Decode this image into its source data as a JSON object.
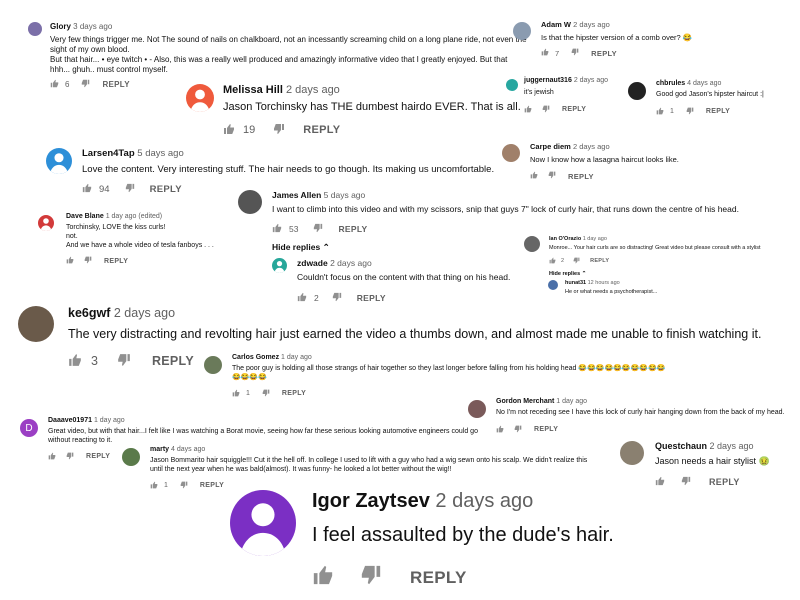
{
  "comments": {
    "glory": {
      "author": "Glory",
      "time": "3 days ago",
      "lines": [
        "Very few things trigger me. Not The sound of nails on chalkboard, not an incessantly screaming child on a long plane ride, not even the",
        "sight of my own blood.",
        "But that hair... • eye twitch •  - Also, this was a really well produced and amazingly informative video that I greatly enjoyed.  But that",
        "hhh... ghuh.. must control myself."
      ],
      "likes": "6",
      "reply": "REPLY",
      "avatar_color": "#7b6fa8"
    },
    "melissa": {
      "author": "Melissa Hill",
      "time": "2 days ago",
      "lines": [
        "Jason Torchinsky has THE dumbest hairdo EVER. That is all."
      ],
      "likes": "19",
      "reply": "REPLY",
      "avatar_color": "#ef5a3c"
    },
    "adam": {
      "author": "Adam W",
      "time": "2 days ago",
      "lines": [
        "Is that the hipster version of a comb over? 😂"
      ],
      "likes": "7",
      "reply": "REPLY",
      "avatar_color": "#8a9bb0"
    },
    "juggernaut": {
      "author": "juggernaut316",
      "time": "2 days ago",
      "lines": [
        "it's jewish"
      ],
      "likes": "",
      "reply": "REPLY",
      "avatar_color": "#27a7a0"
    },
    "chbrules": {
      "author": "chbrules",
      "time": "4 days ago",
      "lines": [
        "Good god Jason's hipster haircut :|"
      ],
      "likes": "1",
      "reply": "REPLY",
      "avatar_color": "#222222"
    },
    "larsen": {
      "author": "Larsen4Tap",
      "time": "5 days ago",
      "lines": [
        "Love the content. Very interesting stuff.  The hair needs to go though. Its making us uncomfortable."
      ],
      "likes": "94",
      "reply": "REPLY",
      "avatar_color": "#2d8fd8"
    },
    "carpe": {
      "author": "Carpe diem",
      "time": "2 days ago",
      "lines": [
        "Now I know how a lasagna haircut looks like."
      ],
      "likes": "",
      "reply": "REPLY",
      "avatar_color": "#a0806a"
    },
    "james": {
      "author": "James Allen",
      "time": "5 days ago",
      "lines": [
        "I want to climb into this video and with my scissors, snip that guys 7\" lock of curly hair, that runs down the centre of his head."
      ],
      "likes": "53",
      "reply": "REPLY",
      "hide": "Hide replies",
      "avatar_color": "#555555"
    },
    "dave": {
      "author": "Dave Blane",
      "time": "1 day ago (edited)",
      "lines": [
        "Torchinsky,  LOVE the kiss curls!",
        "not.",
        "And we have a whole video of tesla fanboys . . ."
      ],
      "likes": "",
      "reply": "REPLY",
      "avatar_color": "#d23a3a"
    },
    "zdwade": {
      "author": "zdwade",
      "time": "2 days ago",
      "lines": [
        "Couldn't focus on the content with that thing on his head."
      ],
      "likes": "2",
      "reply": "REPLY",
      "avatar_color": "#27a79a"
    },
    "ian": {
      "author": "Ian O'Orazio",
      "time": "1 day ago",
      "lines": [
        "Monroe... Your hair curls are so distracting!  Great video but please consult with a stylist"
      ],
      "likes": "2",
      "reply": "REPLY",
      "hide": "Hide replies",
      "avatar_color": "#666666"
    },
    "hunat": {
      "author": "hunat31",
      "time": "12 hours ago",
      "lines": [
        "He or what needs a psychotherapist..."
      ],
      "avatar_color": "#4a6fa8"
    },
    "ke6gwf": {
      "author": "ke6gwf",
      "time": "2 days ago",
      "lines": [
        "The very distracting and revolting hair just earned the video a thumbs down, and almost made me unable to finish watching it."
      ],
      "likes": "3",
      "reply": "REPLY",
      "avatar_color": "#6a5a4a"
    },
    "carlos": {
      "author": "Carlos Gomez",
      "time": "1 day ago",
      "lines": [
        "The poor guy is holding all those strangs of hair together so they last longer before falling from his holding head 😂😂😂😂😂😂😂😂😂😂",
        "😂😂😂😂"
      ],
      "likes": "1",
      "reply": "REPLY",
      "avatar_color": "#6a7a5a"
    },
    "gordon": {
      "author": "Gordon Merchant",
      "time": "1 day ago",
      "lines": [
        "No I'm not receding see I have this lock of curly hair hanging down from the back of my head."
      ],
      "likes": "",
      "reply": "REPLY",
      "avatar_color": "#7a5a5a"
    },
    "daaave": {
      "author": "Daaave01971",
      "time": "1 day ago",
      "initial": "D",
      "lines": [
        "Great video, but with that hair...I felt like I was watching a Borat movie, seeing how far these serious looking automotive engineers could go",
        "without reacting to it."
      ],
      "likes": "",
      "reply": "REPLY",
      "avatar_color": "#9b3fc4"
    },
    "marty": {
      "author": "marty",
      "time": "4 days ago",
      "lines": [
        "Jason Bommarito hair squiggle!!! Cut it the hell off. In college I used to lift with a guy who had a wig sewn onto his scalp. We didn't realize this",
        "until the next year when he was bald(almost). It was funny- he looked a lot better without the wig!!"
      ],
      "likes": "1",
      "reply": "REPLY",
      "avatar_color": "#5a7a4a"
    },
    "quest": {
      "author": "Questchaun",
      "time": "2 days ago",
      "lines": [
        "Jason needs a hair stylist 🤢"
      ],
      "likes": "",
      "reply": "REPLY",
      "avatar_color": "#8a8070"
    },
    "igor": {
      "author": "Igor Zaytsev",
      "time": "2 days ago",
      "lines": [
        "I feel assaulted by the dude's hair."
      ],
      "likes": "",
      "reply": "REPLY",
      "avatar_color": "#7b2fc4"
    }
  },
  "icons": {
    "like": "thumbs-up-icon",
    "dislike": "thumbs-down-icon",
    "person": "person-icon"
  }
}
